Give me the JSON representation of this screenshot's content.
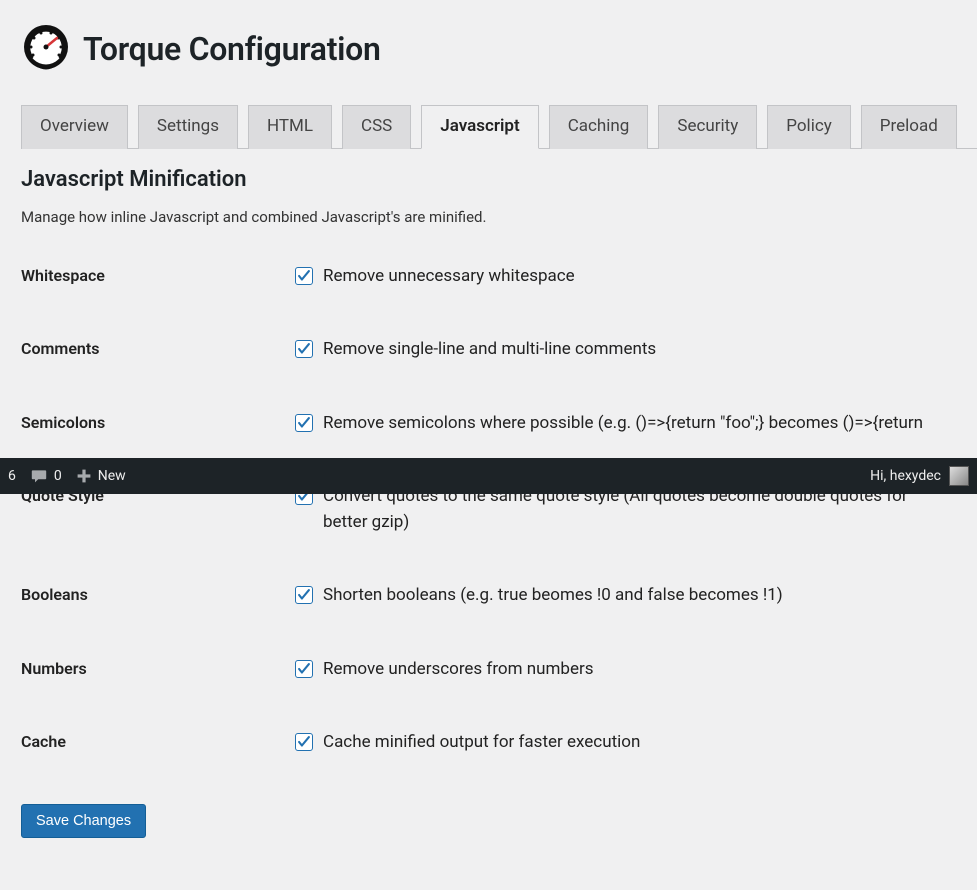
{
  "header": {
    "title": "Torque Configuration"
  },
  "tabs": [
    {
      "label": "Overview",
      "active": false
    },
    {
      "label": "Settings",
      "active": false
    },
    {
      "label": "HTML",
      "active": false
    },
    {
      "label": "CSS",
      "active": false
    },
    {
      "label": "Javascript",
      "active": true
    },
    {
      "label": "Caching",
      "active": false
    },
    {
      "label": "Security",
      "active": false
    },
    {
      "label": "Policy",
      "active": false
    },
    {
      "label": "Preload",
      "active": false
    }
  ],
  "section": {
    "title": "Javascript Minification",
    "description": "Manage how inline Javascript and combined Javascript's are minified."
  },
  "options": [
    {
      "name": "Whitespace",
      "label": "Remove unnecessary whitespace",
      "checked": true
    },
    {
      "name": "Comments",
      "label": "Remove single-line and multi-line comments",
      "checked": true
    },
    {
      "name": "Semicolons",
      "label": "Remove semicolons where possible (e.g. ()=>{return \"foo\";} becomes ()=>{return",
      "checked": true
    },
    {
      "name": "Quote Style",
      "label": "Convert quotes to the same quote style (All quotes become double quotes for better gzip)",
      "checked": true
    },
    {
      "name": "Booleans",
      "label": "Shorten booleans (e.g. true beomes !0 and false becomes !1)",
      "checked": true
    },
    {
      "name": "Numbers",
      "label": "Remove underscores from numbers",
      "checked": true
    },
    {
      "name": "Cache",
      "label": "Cache minified output for faster execution",
      "checked": true
    }
  ],
  "submit": {
    "label": "Save Changes"
  },
  "admin_bar": {
    "updates": "6",
    "comments": "0",
    "new_label": "New",
    "greeting": "Hi, hexydec"
  }
}
